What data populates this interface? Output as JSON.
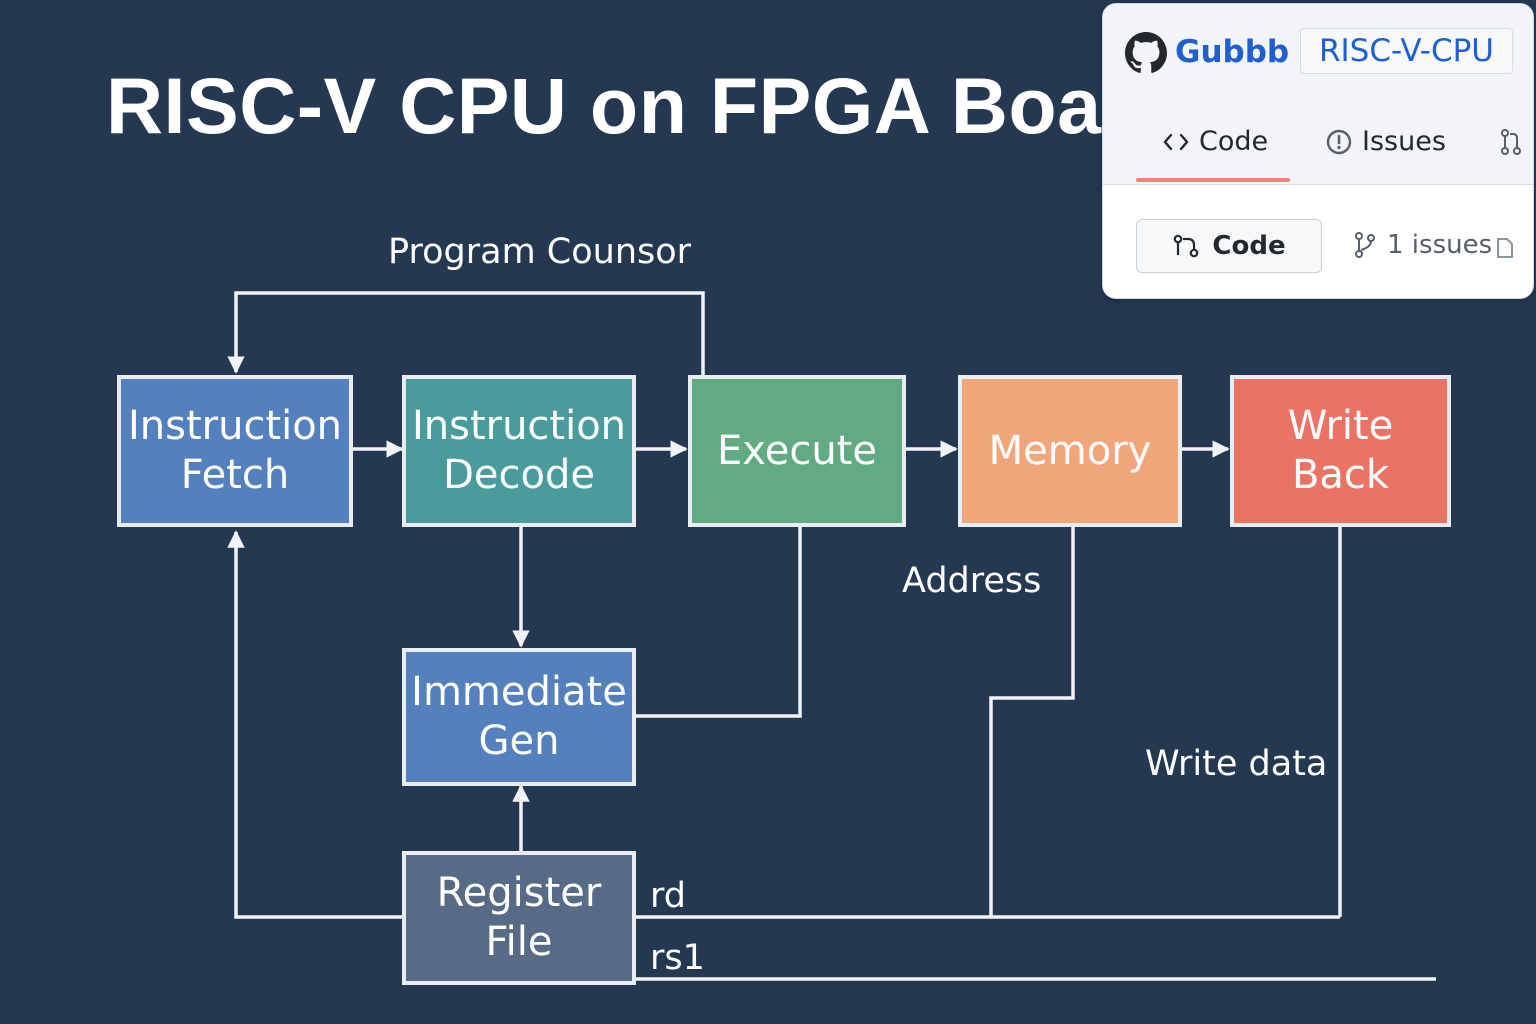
{
  "title": "RISC-V CPU on FPGA Board",
  "diagram": {
    "blocks": {
      "fetch": {
        "lines": [
          "Instruction",
          "Fetch"
        ],
        "color": "#5481bd"
      },
      "decode": {
        "lines": [
          "Instruction",
          "Decode"
        ],
        "color": "#4a9c9c"
      },
      "execute": {
        "lines": [
          "Execute"
        ],
        "color": "#62ab82"
      },
      "memory": {
        "lines": [
          "Memory"
        ],
        "color": "#f0a67a"
      },
      "writeback": {
        "lines": [
          "Write",
          "Back"
        ],
        "color": "#ea7366"
      },
      "immgen": {
        "lines": [
          "Immediate",
          "Gen"
        ],
        "color": "#5481bd"
      },
      "regfile": {
        "lines": [
          "Register",
          "File"
        ],
        "color": "#586b86"
      }
    },
    "labels": {
      "program_counter": "Program Counsor",
      "address": "Address",
      "write_data": "Write data",
      "rd": "rd",
      "rs1": "rs1"
    },
    "line_color": "#f1f4f7"
  },
  "repo_panel": {
    "owner": "Gubbb",
    "repo": "RISC-V-CPU",
    "tabs": {
      "code": "Code",
      "issues": "Issues"
    },
    "code_button": "Code",
    "issues_count": "1 issues",
    "owner_color": "#1f5fd0",
    "active_tab_underline": "#f0827a",
    "icons": [
      "github-logo-icon",
      "code-brackets-icon",
      "issue-circle-icon",
      "pull-request-icon",
      "branch-icon"
    ]
  }
}
